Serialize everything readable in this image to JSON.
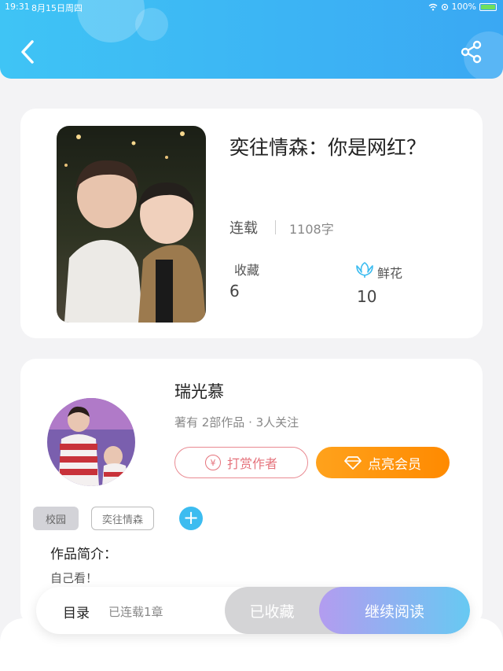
{
  "status_bar": {
    "time": "19:31",
    "date": "8月15日周四",
    "battery": "100%"
  },
  "header": {
    "back_icon": "chevron-left-icon",
    "share_icon": "share-icon"
  },
  "book": {
    "title": "奕往情森：你是网红？",
    "status": "连载",
    "word_count": "1108字",
    "favorites_label": "收藏",
    "favorites_value": "6",
    "flowers_label": "鲜花",
    "flowers_value": "10"
  },
  "author": {
    "name": "瑞光慕",
    "stats": "著有 2部作品 · 3人关注",
    "tip_label": "打赏作者",
    "vip_label": "点亮会员"
  },
  "tags": [
    "校园",
    "奕往情森"
  ],
  "intro": {
    "label": "作品简介：",
    "text": "自己看！"
  },
  "bottom_bar": {
    "toc_label": "目录",
    "chapter_count": "已连载1章",
    "collected_label": "已收藏",
    "continue_label": "继续阅读"
  },
  "colors": {
    "header": "#3fc4f5",
    "vip": "#ff8a00",
    "tip": "#e5737c",
    "accent": "#3cbcf0"
  }
}
